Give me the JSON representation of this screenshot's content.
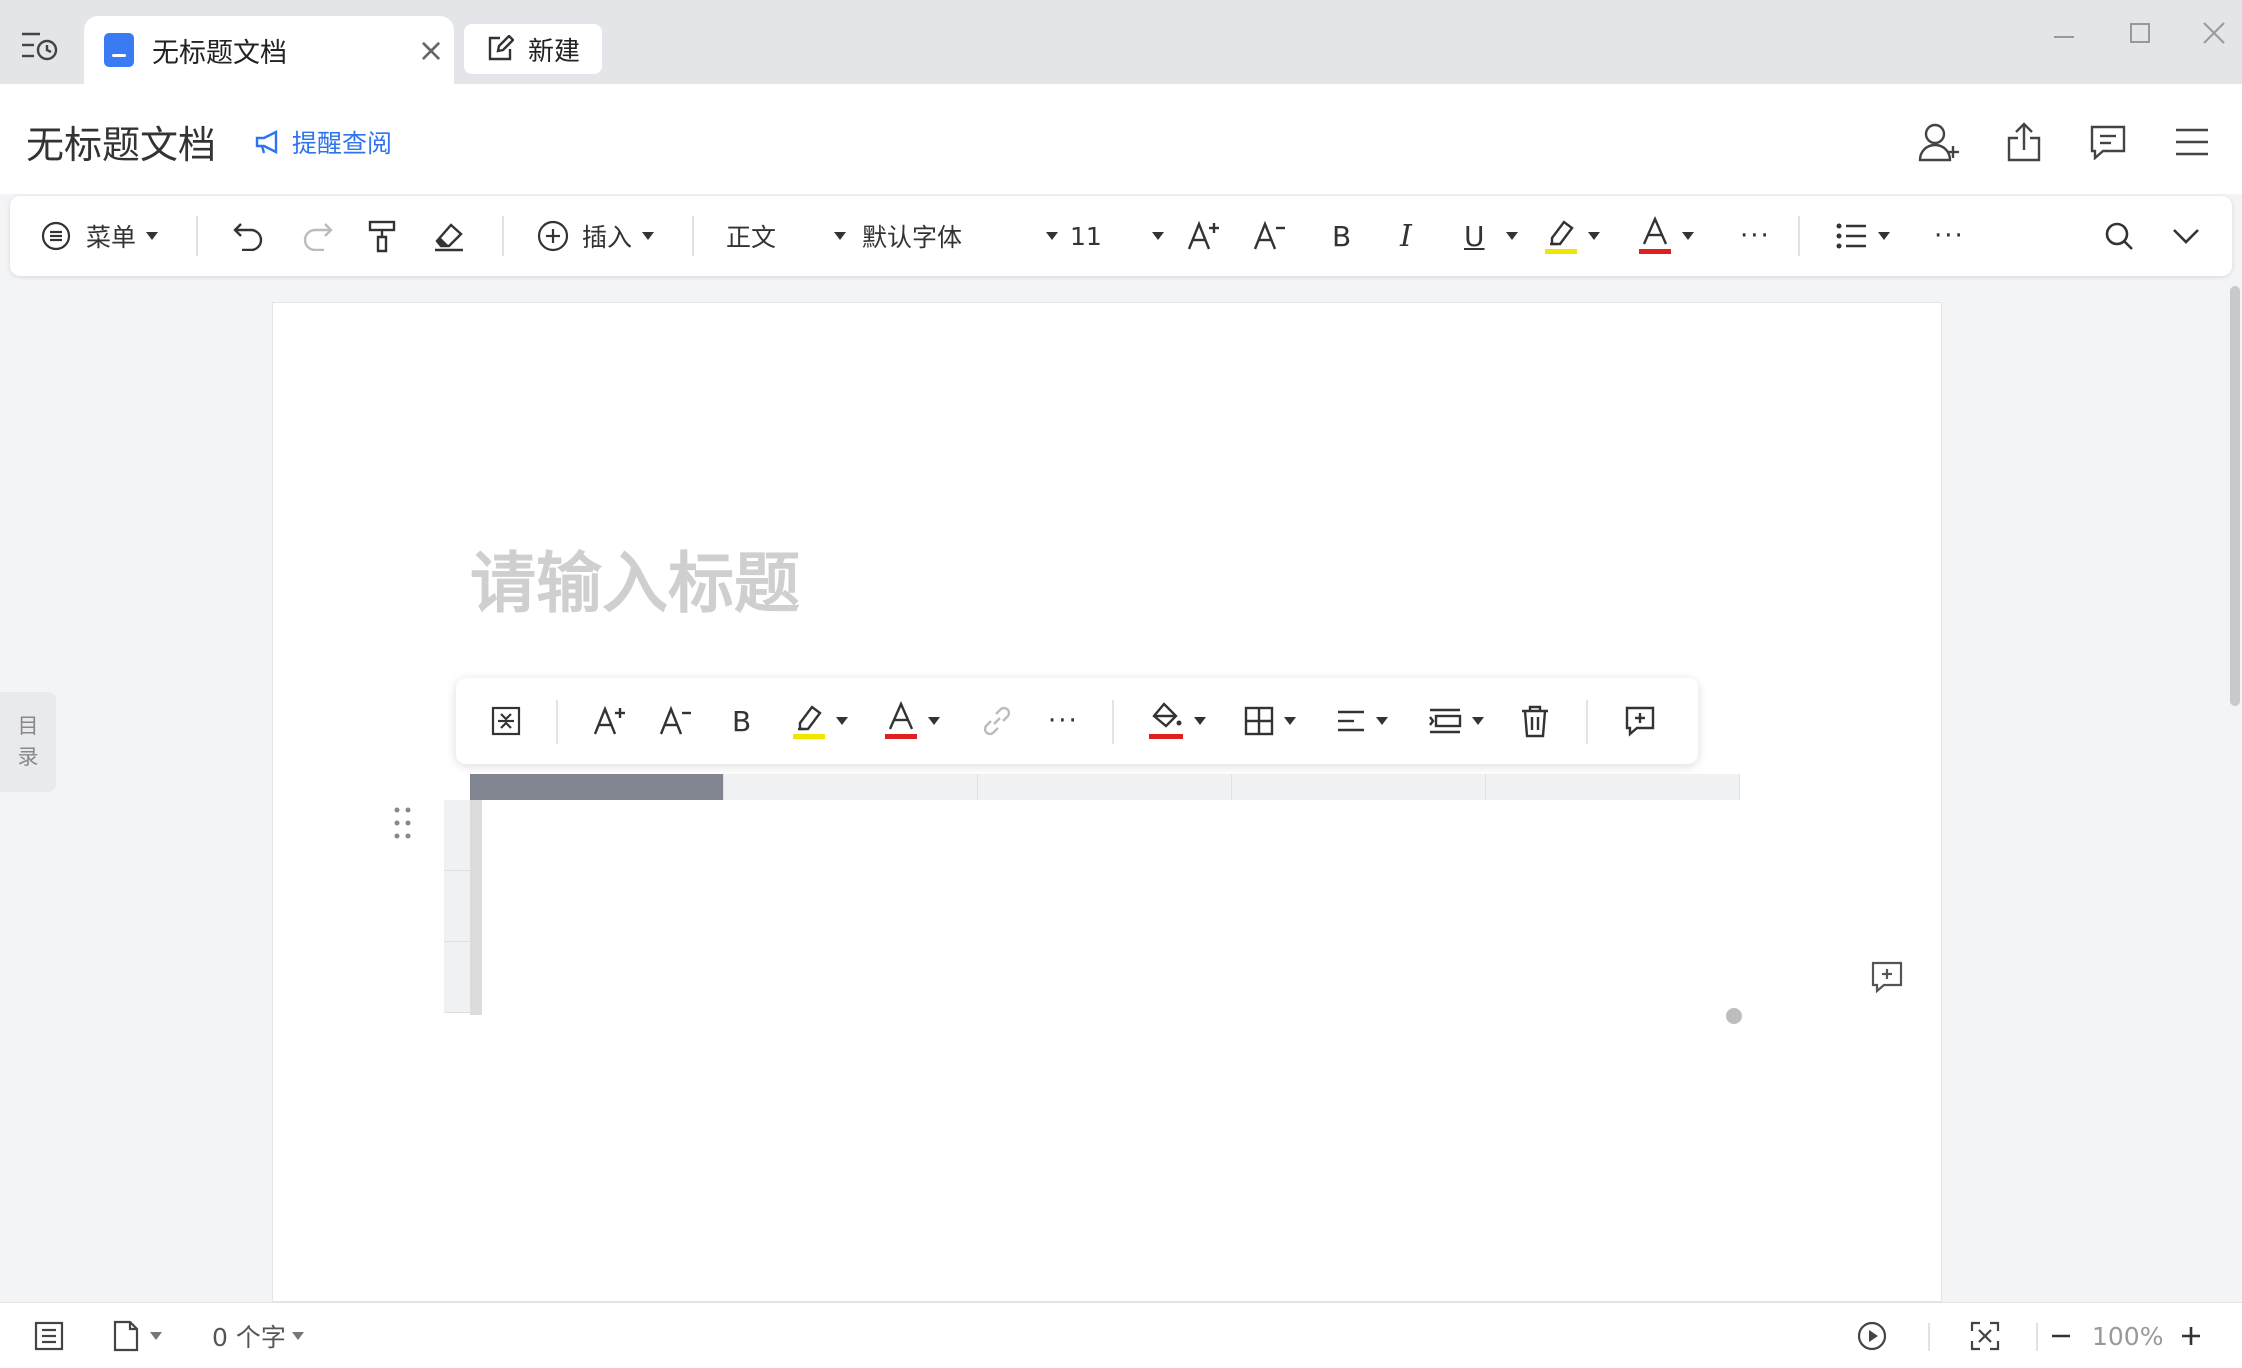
{
  "tabs": [
    {
      "label": "无标题文档",
      "close": "×"
    }
  ],
  "new_button": {
    "label": "新建"
  },
  "header": {
    "doc_title": "无标题文档",
    "remind_label": "提醒查阅"
  },
  "toolbar": {
    "menu_label": "菜单",
    "insert_label": "插入",
    "style_value": "正文",
    "font_value": "默认字体",
    "size_value": "11",
    "bold": "B",
    "italic": "I",
    "underline": "U",
    "more": "···",
    "more2": "···"
  },
  "sidebar": {
    "toc_label_1": "目",
    "toc_label_2": "录"
  },
  "document": {
    "title_placeholder": "请输入标题",
    "table": {
      "rows": 3,
      "cols": 5,
      "selected_column": 1
    }
  },
  "table_toolbar": {
    "bold": "B",
    "more": "···"
  },
  "statusbar": {
    "word_count": "0 个字",
    "zoom": "100%"
  },
  "colors": {
    "accent": "#2f74ee",
    "highlight_underline": "#f0e600",
    "font_color_underline": "#e02020",
    "selection": "#bdd6fb"
  }
}
